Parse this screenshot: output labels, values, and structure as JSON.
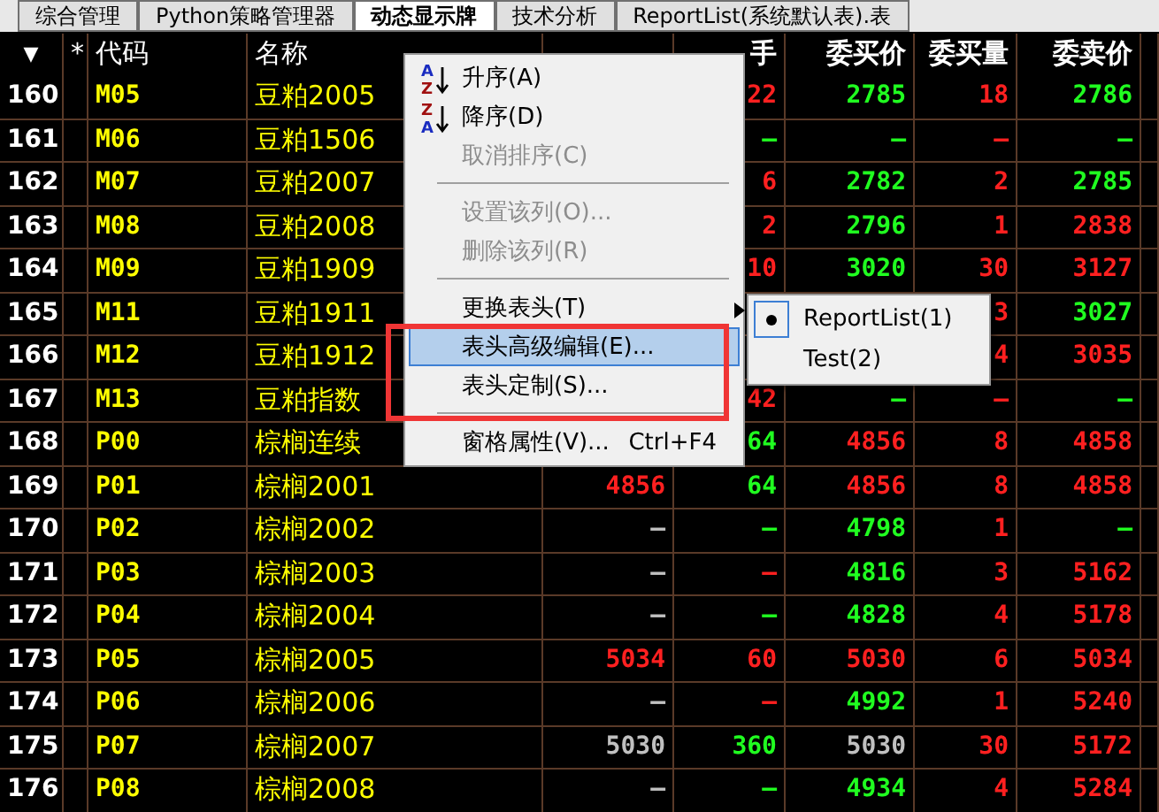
{
  "tabs": [
    {
      "label": "综合管理",
      "selected": false
    },
    {
      "label": "Python策略管理器",
      "selected": false
    },
    {
      "label": "动态显示牌",
      "selected": true
    },
    {
      "label": "技术分析",
      "selected": false
    },
    {
      "label": "ReportList(系统默认表).表",
      "selected": false
    }
  ],
  "table": {
    "columns": [
      "▼",
      "*",
      "代码",
      "名称",
      null,
      "手",
      "委买价",
      "委买量",
      "委卖价"
    ],
    "rows": [
      {
        "number": "160",
        "code": "M05",
        "name": "豆粕2005",
        "cells": [
          null,
          {
            "text": "22",
            "color": "#ff2020"
          },
          {
            "text": "2785",
            "color": "#20ff20"
          },
          {
            "text": "18",
            "color": "#ff2020"
          },
          {
            "text": "2786",
            "color": "#20ff20"
          }
        ]
      },
      {
        "number": "161",
        "code": "M06",
        "name": "豆粕1506",
        "cells": [
          null,
          {
            "text": "—",
            "color": "#20ff20"
          },
          {
            "text": "—",
            "color": "#20ff20"
          },
          {
            "text": "—",
            "color": "#ff2020"
          },
          {
            "text": "—",
            "color": "#20ff20"
          }
        ]
      },
      {
        "number": "162",
        "code": "M07",
        "name": "豆粕2007",
        "cells": [
          null,
          {
            "text": "6",
            "color": "#ff2020"
          },
          {
            "text": "2782",
            "color": "#20ff20"
          },
          {
            "text": "2",
            "color": "#ff2020"
          },
          {
            "text": "2785",
            "color": "#20ff20"
          }
        ]
      },
      {
        "number": "163",
        "code": "M08",
        "name": "豆粕2008",
        "cells": [
          null,
          {
            "text": "2",
            "color": "#ff2020"
          },
          {
            "text": "2796",
            "color": "#20ff20"
          },
          {
            "text": "1",
            "color": "#ff2020"
          },
          {
            "text": "2838",
            "color": "#ff2020"
          }
        ]
      },
      {
        "number": "164",
        "code": "M09",
        "name": "豆粕1909",
        "cells": [
          null,
          {
            "text": "10",
            "color": "#ff2020"
          },
          {
            "text": "3020",
            "color": "#20ff20"
          },
          {
            "text": "30",
            "color": "#ff2020"
          },
          {
            "text": "3127",
            "color": "#ff2020"
          }
        ]
      },
      {
        "number": "165",
        "code": "M11",
        "name": "豆粕1911",
        "cells": [
          null,
          null,
          null,
          {
            "text": "3",
            "color": "#ff2020"
          },
          {
            "text": "3027",
            "color": "#20ff20"
          }
        ]
      },
      {
        "number": "166",
        "code": "M12",
        "name": "豆粕1912",
        "cells": [
          null,
          null,
          null,
          {
            "text": "4",
            "color": "#ff2020"
          },
          {
            "text": "3035",
            "color": "#ff2020"
          }
        ]
      },
      {
        "number": "167",
        "code": "M13",
        "name": "豆粕指数",
        "cells": [
          null,
          {
            "text": "42",
            "color": "#ff2020"
          },
          {
            "text": "—",
            "color": "#20ff20"
          },
          {
            "text": "—",
            "color": "#ff2020"
          },
          {
            "text": "—",
            "color": "#20ff20"
          }
        ]
      },
      {
        "number": "168",
        "code": "P00",
        "name": "棕榈连续",
        "cells": [
          null,
          {
            "text": "64",
            "color": "#20ff20"
          },
          {
            "text": "4856",
            "color": "#ff2020"
          },
          {
            "text": "8",
            "color": "#ff2020"
          },
          {
            "text": "4858",
            "color": "#ff2020"
          }
        ]
      },
      {
        "number": "169",
        "code": "P01",
        "name": "棕榈2001",
        "cells": [
          {
            "text": "4856",
            "color": "#ff2020"
          },
          {
            "text": "64",
            "color": "#20ff20"
          },
          {
            "text": "4856",
            "color": "#ff2020"
          },
          {
            "text": "8",
            "color": "#ff2020"
          },
          {
            "text": "4858",
            "color": "#ff2020"
          }
        ]
      },
      {
        "number": "170",
        "code": "P02",
        "name": "棕榈2002",
        "cells": [
          {
            "text": "—",
            "color": "#c0c0c0"
          },
          {
            "text": "—",
            "color": "#20ff20"
          },
          {
            "text": "4798",
            "color": "#20ff20"
          },
          {
            "text": "1",
            "color": "#ff2020"
          },
          {
            "text": "—",
            "color": "#20ff20"
          }
        ]
      },
      {
        "number": "171",
        "code": "P03",
        "name": "棕榈2003",
        "cells": [
          {
            "text": "—",
            "color": "#c0c0c0"
          },
          {
            "text": "—",
            "color": "#ff2020"
          },
          {
            "text": "4816",
            "color": "#20ff20"
          },
          {
            "text": "3",
            "color": "#ff2020"
          },
          {
            "text": "5162",
            "color": "#ff2020"
          }
        ]
      },
      {
        "number": "172",
        "code": "P04",
        "name": "棕榈2004",
        "cells": [
          {
            "text": "—",
            "color": "#c0c0c0"
          },
          {
            "text": "—",
            "color": "#20ff20"
          },
          {
            "text": "4828",
            "color": "#20ff20"
          },
          {
            "text": "4",
            "color": "#ff2020"
          },
          {
            "text": "5178",
            "color": "#ff2020"
          }
        ]
      },
      {
        "number": "173",
        "code": "P05",
        "name": "棕榈2005",
        "cells": [
          {
            "text": "5034",
            "color": "#ff2020"
          },
          {
            "text": "60",
            "color": "#ff2020"
          },
          {
            "text": "5030",
            "color": "#ff2020"
          },
          {
            "text": "6",
            "color": "#ff2020"
          },
          {
            "text": "5034",
            "color": "#ff2020"
          }
        ]
      },
      {
        "number": "174",
        "code": "P06",
        "name": "棕榈2006",
        "cells": [
          {
            "text": "—",
            "color": "#c0c0c0"
          },
          {
            "text": "—",
            "color": "#ff2020"
          },
          {
            "text": "4992",
            "color": "#20ff20"
          },
          {
            "text": "1",
            "color": "#ff2020"
          },
          {
            "text": "5240",
            "color": "#ff2020"
          }
        ]
      },
      {
        "number": "175",
        "code": "P07",
        "name": "棕榈2007",
        "cells": [
          {
            "text": "5030",
            "color": "#c0c0c0"
          },
          {
            "text": "360",
            "color": "#20ff20"
          },
          {
            "text": "5030",
            "color": "#c0c0c0"
          },
          {
            "text": "30",
            "color": "#ff2020"
          },
          {
            "text": "5172",
            "color": "#ff2020"
          }
        ]
      },
      {
        "number": "176",
        "code": "P08",
        "name": "棕榈2008",
        "cells": [
          {
            "text": "—",
            "color": "#c0c0c0"
          },
          {
            "text": "—",
            "color": "#20ff20"
          },
          {
            "text": "4934",
            "color": "#20ff20"
          },
          {
            "text": "4",
            "color": "#ff2020"
          },
          {
            "text": "5284",
            "color": "#ff2020"
          }
        ]
      }
    ]
  },
  "context_menu": {
    "items": [
      {
        "kind": "sort-ascending",
        "label": "升序(A)",
        "icon_text": "AZ",
        "disabled": false,
        "selected": false
      },
      {
        "kind": "sort-descending",
        "label": "降序(D)",
        "icon_text": "ZA",
        "disabled": false,
        "selected": false
      },
      {
        "kind": "item",
        "label": "取消排序(C)",
        "disabled": true,
        "selected": false
      },
      {
        "kind": "separator"
      },
      {
        "kind": "item",
        "label": "设置该列(O)...",
        "disabled": true,
        "selected": false
      },
      {
        "kind": "item",
        "label": "删除该列(R)",
        "disabled": true,
        "selected": false
      },
      {
        "kind": "separator"
      },
      {
        "kind": "submenu",
        "label": "更换表头(T)",
        "disabled": false,
        "selected": false
      },
      {
        "kind": "item",
        "label": "表头高级编辑(E)...",
        "disabled": false,
        "selected": true
      },
      {
        "kind": "item",
        "label": "表头定制(S)...",
        "disabled": false,
        "selected": false
      },
      {
        "kind": "separator"
      },
      {
        "kind": "item",
        "label": "窗格属性(V)...",
        "shortcut": "Ctrl+F4",
        "disabled": false,
        "selected": false
      }
    ]
  },
  "submenu": {
    "items": [
      {
        "label": "ReportList(1)",
        "selected": true
      },
      {
        "label": "Test(2)",
        "selected": false
      }
    ]
  }
}
